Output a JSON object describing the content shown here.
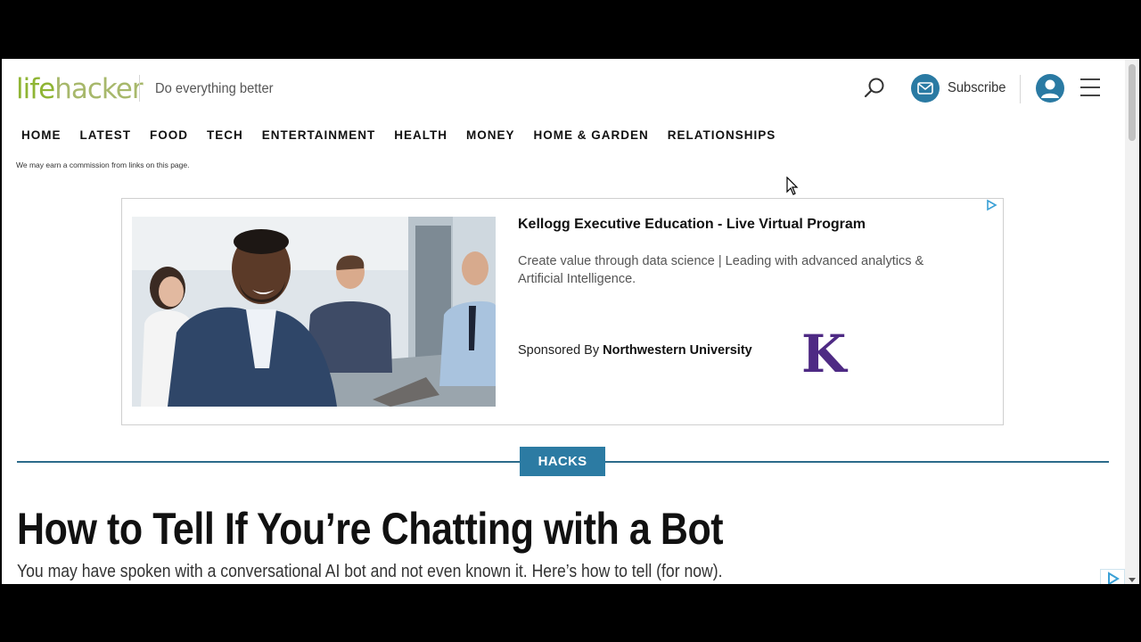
{
  "header": {
    "logo_life": "life",
    "logo_hacker": "hacker",
    "tagline": "Do everything better",
    "subscribe_label": "Subscribe"
  },
  "nav": {
    "items": [
      {
        "label": "HOME"
      },
      {
        "label": "LATEST"
      },
      {
        "label": "FOOD"
      },
      {
        "label": "TECH"
      },
      {
        "label": "ENTERTAINMENT"
      },
      {
        "label": "HEALTH"
      },
      {
        "label": "MONEY"
      },
      {
        "label": "HOME & GARDEN"
      },
      {
        "label": "RELATIONSHIPS"
      }
    ]
  },
  "disclaimer": "We may earn a commission from links on this page.",
  "ad": {
    "title": "Kellogg Executive Education - Live Virtual Program",
    "description": "Create value through data science | Leading with advanced analytics & Artificial Intelligence.",
    "sponsored_prefix": "Sponsored By",
    "sponsor_name": "Northwestern University",
    "logo_letter": "K",
    "logo_color": "#4e2a84"
  },
  "article": {
    "category": "HACKS",
    "headline": "How to Tell If You’re Chatting with a Bot",
    "subheadline": "You may have spoken with a conversational AI bot and not even known it. Here’s how to tell (for now)."
  },
  "colors": {
    "brand_green": "#8fb534",
    "accent_blue": "#2c7ba3"
  },
  "icons": {
    "search": "search-icon",
    "subscribe": "mail-icon",
    "account": "user-icon",
    "menu": "hamburger-menu-icon",
    "ad_choices": "adchoices-icon"
  }
}
